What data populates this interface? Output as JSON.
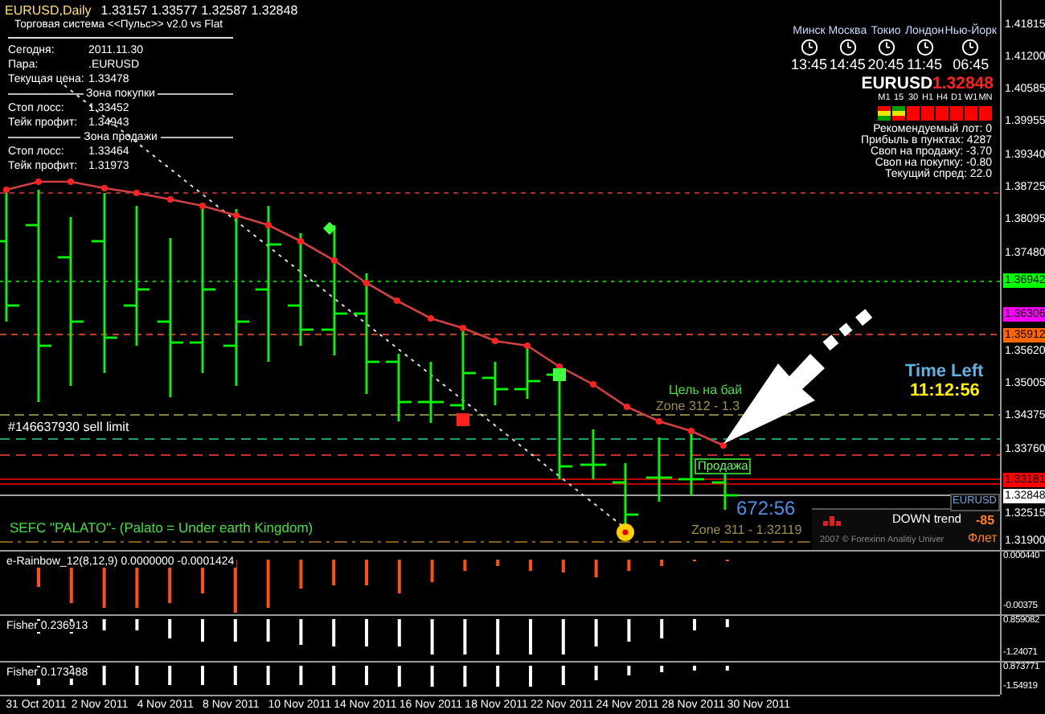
{
  "header": {
    "symbol": "EURUSD,Daily",
    "prices": "1.33157 1.33577 1.32587 1.32848"
  },
  "system_panel": {
    "title": "Торговая система <<Пульс>> v2.0 vs Flat",
    "rows": [
      {
        "kind": "field",
        "label": "Сегодня:",
        "value": "2011.11.30"
      },
      {
        "kind": "field",
        "label": "Пара:",
        "value": ".EURUSD"
      },
      {
        "kind": "field",
        "label": "Текущая цена:",
        "value": "1.33478"
      },
      {
        "kind": "section",
        "label": "Зона покупки"
      },
      {
        "kind": "field",
        "label": "Стоп лосс:",
        "value": "1.33452"
      },
      {
        "kind": "field",
        "label": "Тейк профит:",
        "value": "1.34943"
      },
      {
        "kind": "section",
        "label": "Зона продажи"
      },
      {
        "kind": "field",
        "label": "Стоп лосс:",
        "value": "1.33464"
      },
      {
        "kind": "field",
        "label": "Тейк профит:",
        "value": "1.31973"
      }
    ]
  },
  "clocks": [
    {
      "city": "Минск",
      "time": "13:45"
    },
    {
      "city": "Москва",
      "time": "14:45"
    },
    {
      "city": "Токио",
      "time": "20:45"
    },
    {
      "city": "Лондон",
      "time": "11:45"
    },
    {
      "city": "Нью-Йорк",
      "time": "06:45"
    }
  ],
  "quote": {
    "symbol": "EURUSD",
    "price": "1.32848"
  },
  "timeframes": [
    {
      "label": "M1",
      "cells": [
        {
          "color": "#ff0000"
        },
        {
          "color": "#e8e800"
        },
        {
          "color": "#00a000"
        }
      ]
    },
    {
      "label": "15",
      "cells": [
        {
          "color": "#00a000"
        },
        {
          "color": "#e8e800"
        },
        {
          "color": "#ff0000"
        }
      ]
    },
    {
      "label": "30",
      "cells": [
        {
          "color": "#ff0000"
        },
        {
          "color": "#ff0000"
        },
        {
          "color": "#ff0000"
        }
      ]
    },
    {
      "label": "H1",
      "cells": [
        {
          "color": "#ff0000"
        },
        {
          "color": "#ff0000"
        },
        {
          "color": "#ff0000"
        }
      ]
    },
    {
      "label": "H4",
      "cells": [
        {
          "color": "#ff0000"
        },
        {
          "color": "#ff0000"
        },
        {
          "color": "#ff0000"
        }
      ]
    },
    {
      "label": "D1",
      "cells": [
        {
          "color": "#ff0000"
        },
        {
          "color": "#ff0000"
        },
        {
          "color": "#ff0000"
        }
      ]
    },
    {
      "label": "W1",
      "cells": [
        {
          "color": "#ff0000"
        },
        {
          "color": "#ff0000"
        },
        {
          "color": "#ff0000"
        }
      ]
    },
    {
      "label": "MN",
      "cells": [
        {
          "color": "#ff0000"
        },
        {
          "color": "#ff0000"
        },
        {
          "color": "#ff0000"
        }
      ]
    }
  ],
  "stats": [
    "Рекомендуемый лот: 0",
    "Прибыль в пунктах: 4287",
    "Своп на продажу: -3.70",
    "Своп на покупку: -0.80",
    "Текущий спред: 22.0"
  ],
  "order_label": "#146637930 sell limit",
  "buy_target": "Цель на бай",
  "zone_upper": "Zone 312 - 1.3",
  "sell_label": "Продажа",
  "timer": "672:56",
  "time_left": {
    "label": "Time Left",
    "value": "11:12:56"
  },
  "trend_panel": {
    "symbol": "EURUSD",
    "trend": "DOWN trend",
    "value": "-85",
    "state": "Флет",
    "copyright": "2007 © Forexinn Analitiy Univer"
  },
  "indicator_name": "SEFC \"PALATO\"- (Palato = Under earth Kingdom)",
  "zone_lower": "Zone 311 - 1.32119",
  "price_axis": [
    {
      "kind": "tick",
      "label": "1.41815"
    },
    {
      "kind": "tick",
      "label": "1.41200"
    },
    {
      "kind": "tick",
      "label": "1.40585"
    },
    {
      "kind": "tick",
      "label": "1.39955"
    },
    {
      "kind": "tick",
      "label": "1.39340"
    },
    {
      "kind": "tick",
      "label": "1.38725"
    },
    {
      "kind": "tick",
      "label": "1.38095"
    },
    {
      "kind": "tick",
      "label": "1.37480"
    },
    {
      "kind": "marker",
      "label": "1.36942",
      "color": "#00ff00"
    },
    {
      "kind": "marker",
      "label": "1.36306",
      "color": "#ff00ff"
    },
    {
      "kind": "marker",
      "label": "1.35912",
      "color": "#ff6600"
    },
    {
      "kind": "tick",
      "label": "1.35620"
    },
    {
      "kind": "tick",
      "label": "1.35005"
    },
    {
      "kind": "tick",
      "label": "1.34375"
    },
    {
      "kind": "tick",
      "label": "1.33760"
    },
    {
      "kind": "marker",
      "label": "1.33181",
      "color": "#ff0000"
    },
    {
      "kind": "marker",
      "label": "1.32848",
      "color": "#ffffff"
    },
    {
      "kind": "tick",
      "label": "1.32515"
    },
    {
      "kind": "tick",
      "label": "1.31900"
    }
  ],
  "panes": [
    {
      "title": "e-Rainbow_12(8,12,9) 0.0000000 -0.0001424",
      "axis": [
        "0.000440",
        "-0.00375"
      ]
    },
    {
      "title": "Fisher 0.236913",
      "axis": [
        "0.859082",
        "-1.24071"
      ]
    },
    {
      "title": "Fisher 0.173488",
      "axis": [
        "0.873771",
        "-1.54919"
      ]
    }
  ],
  "dates": [
    "31 Oct 2011",
    "2 Nov 2011",
    "4 Nov 2011",
    "8 Nov 2011",
    "10 Nov 2011",
    "14 Nov 2011",
    "16 Nov 2011",
    "18 Nov 2011",
    "22 Nov 2011",
    "24 Nov 2011",
    "28 Nov 2011",
    "30 Nov 2011"
  ]
}
